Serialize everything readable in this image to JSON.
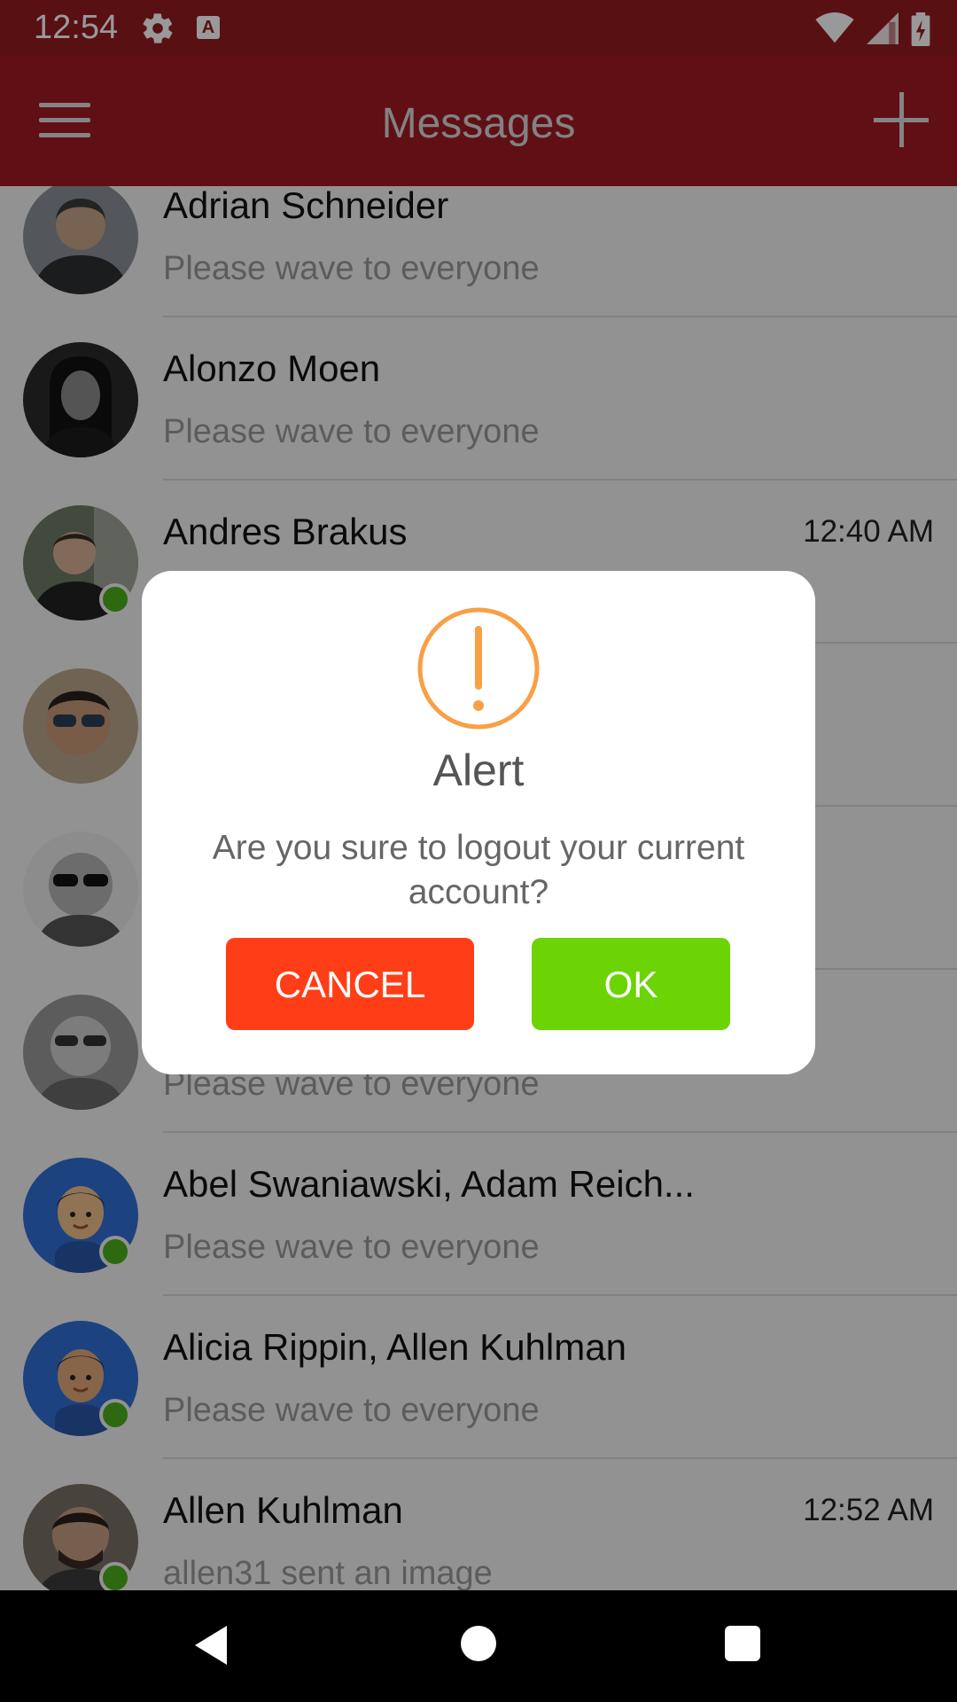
{
  "status_bar": {
    "time": "12:54"
  },
  "app_bar": {
    "title": "Messages"
  },
  "conversations": [
    {
      "name": "Adrian Schneider",
      "message": "Please wave to everyone",
      "time": "",
      "online": false
    },
    {
      "name": "Alonzo Moen",
      "message": "Please wave to everyone",
      "time": "",
      "online": false
    },
    {
      "name": "Andres Brakus",
      "message": "",
      "time": "12:40 AM",
      "online": true
    },
    {
      "name": "",
      "message": "",
      "time": "",
      "online": false
    },
    {
      "name": "",
      "message": "",
      "time": "",
      "online": false
    },
    {
      "name": "",
      "message": "Please wave to everyone",
      "time": "",
      "online": false
    },
    {
      "name": "Abel Swaniawski, Adam Reich...",
      "message": "Please wave to everyone",
      "time": "",
      "online": true
    },
    {
      "name": "Alicia Rippin, Allen Kuhlman",
      "message": "Please wave to everyone",
      "time": "",
      "online": true
    },
    {
      "name": "Allen Kuhlman",
      "message": "allen31 sent an image",
      "time": "12:52 AM",
      "online": true
    }
  ],
  "dialog": {
    "title": "Alert",
    "message": "Are you sure to logout your current account?",
    "cancel_label": "CANCEL",
    "ok_label": "OK"
  },
  "colors": {
    "app_bar": "#a01c24",
    "cancel": "#ff3e17",
    "ok": "#6cd305",
    "alert_icon": "#f7a046",
    "online": "#4caf1a"
  }
}
